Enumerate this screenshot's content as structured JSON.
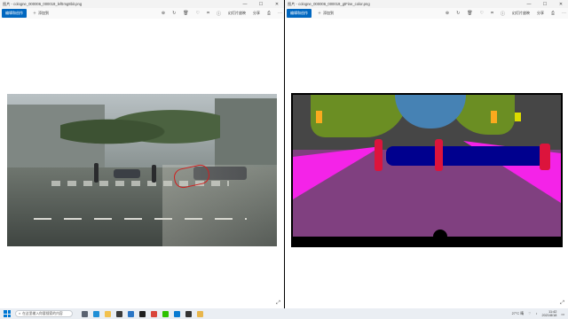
{
  "left_window": {
    "title": "图片 - cologne_000006_000019_leftImg8bit.png",
    "toolbar": {
      "primary": "编辑和创作",
      "add": "添加到",
      "zoom_level": "幻灯片放映",
      "share": "分享"
    }
  },
  "right_window": {
    "title": "图片 - cologne_000006_000019_gtFine_color.png",
    "toolbar": {
      "primary": "编辑和创作",
      "add": "添加到",
      "zoom_level": "幻灯片放映",
      "share": "分享"
    }
  },
  "taskbar": {
    "search_placeholder": "在这里输入你要搜索的内容",
    "weather": "27°C 晴",
    "time": "11:42",
    "date": "2021/8/18"
  },
  "colors": {
    "road": "#804080",
    "sidewalk": "#f423e8",
    "car": "#00008e",
    "person": "#dc143c",
    "vegetation": "#6b8e23",
    "sky": "#4682b4",
    "building": "#464646",
    "traffic_light": "#faaa1e",
    "traffic_sign": "#dcdc00",
    "accent": "#0067c0"
  }
}
